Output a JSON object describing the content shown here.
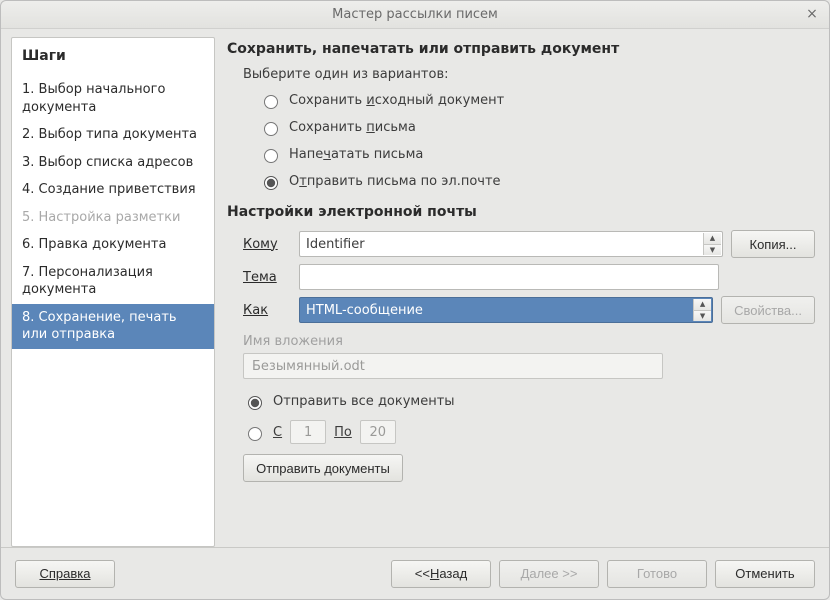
{
  "window": {
    "title": "Мастер рассылки писем"
  },
  "steps": {
    "heading": "Шаги",
    "items": [
      {
        "label": "1. Выбор начального документа",
        "state": "normal"
      },
      {
        "label": "2. Выбор типа документа",
        "state": "normal"
      },
      {
        "label": "3. Выбор списка адресов",
        "state": "normal"
      },
      {
        "label": "4. Создание приветствия",
        "state": "normal"
      },
      {
        "label": "5. Настройка разметки",
        "state": "disabled"
      },
      {
        "label": "6. Правка документа",
        "state": "normal"
      },
      {
        "label": "7. Персонализация документа",
        "state": "normal"
      },
      {
        "label": "8. Сохранение, печать или отправка",
        "state": "active"
      }
    ]
  },
  "main": {
    "heading": "Сохранить, напечатать или отправить документ",
    "choose_text": "Выберите один из вариантов:",
    "options": {
      "save_source": "Сохранить исходный документ",
      "save_letters": "Сохранить письма",
      "print_letters": "Напечатать письма",
      "send_email": "Отправить письма по эл.почте"
    },
    "email_settings_title": "Настройки электронной почты",
    "labels": {
      "to": "Кому",
      "subject": "Тема",
      "as": "Как"
    },
    "to_value": "Identifier",
    "subject_value": "",
    "as_value": "HTML-сообщение",
    "copy_btn": "Копия...",
    "props_btn": "Свойства...",
    "attach_label": "Имя вложения",
    "attach_value": "Безымянный.odt",
    "send_all": "Отправить все документы",
    "from_label": "С",
    "from_value": "1",
    "to_label2": "По",
    "to_value2": "20",
    "send_docs_btn": "Отправить документы"
  },
  "footer": {
    "help": "Справка",
    "back": "<< Назад",
    "next": "Далее >>",
    "finish": "Готово",
    "cancel": "Отменить"
  }
}
